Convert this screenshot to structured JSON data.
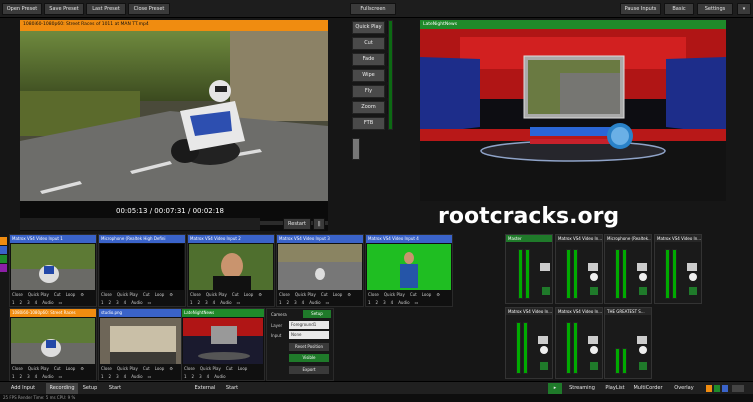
{
  "toolbar": {
    "open_preset": "Open Preset",
    "save_preset": "Save Preset",
    "last_preset": "Last Preset",
    "close_preset": "Close Preset",
    "fullscreen": "Fullscreen",
    "pause_inputs": "Pause Inputs",
    "basic": "Basic",
    "settings": "Settings"
  },
  "preview": {
    "title": "1080i60-1080p60: Street Races of 1011 at MAN TT.mp4",
    "time_elapsed": "00:05:13",
    "time_total": "00:07:31",
    "time_remaining": "00:02:18",
    "separator": "/",
    "restart": "Restart",
    "pause_glyph": "||"
  },
  "transitions": {
    "quick_play": "Quick Play",
    "cut": "Cut",
    "fade": "Fade",
    "wipe": "Wipe",
    "fly": "Fly",
    "zoom": "Zoom",
    "ftb": "FTB"
  },
  "output": {
    "title": "LateNightNews"
  },
  "watermark": "rootcracks.org",
  "inputs": [
    {
      "title": "Matrox VS4 Video Input 1",
      "color": "#3a63c9",
      "f1": [
        "Close",
        "Quick Play",
        "Cut",
        "Loop"
      ],
      "f2": [
        "1",
        "2",
        "3",
        "4",
        "Audio"
      ]
    },
    {
      "title": "Microphone (Realtek High Defini",
      "color": "#3a63c9",
      "f1": [
        "Close",
        "Quick Play",
        "Cut",
        "Loop"
      ],
      "f2": [
        "1",
        "2",
        "3",
        "4",
        "Audio"
      ]
    },
    {
      "title": "Matrox VS4 Video Input 2",
      "color": "#3a63c9",
      "f1": [
        "Close",
        "Quick Play",
        "Cut",
        "Loop"
      ],
      "f2": [
        "1",
        "2",
        "3",
        "4",
        "Audio"
      ]
    },
    {
      "title": "Matrox VS4 Video Input 3",
      "color": "#3a63c9",
      "f1": [
        "Close",
        "Quick Play",
        "Cut",
        "Loop"
      ],
      "f2": [
        "1",
        "2",
        "3",
        "4",
        "Audio"
      ]
    },
    {
      "title": "Matrox VS4 Video Input 4",
      "color": "#3a63c9",
      "f1": [
        "Close",
        "Quick Play",
        "Cut",
        "Loop"
      ],
      "f2": [
        "1",
        "2",
        "3",
        "4",
        "Audio"
      ]
    },
    {
      "title": "1080i60-1080p60: Street Races",
      "color": "#f08c10",
      "f1": [
        "Close",
        "Quick Play",
        "Cut",
        "Loop"
      ],
      "f2": [
        "1",
        "2",
        "3",
        "4",
        "Audio"
      ]
    },
    {
      "title": "studio.png",
      "color": "#3a63c9",
      "f1": [
        "Close",
        "Quick Play",
        "Cut",
        "Loop"
      ],
      "f2": [
        "1",
        "2",
        "3",
        "4",
        "Audio"
      ]
    },
    {
      "title": "LateNightNews",
      "color": "#1f8a2a",
      "f1": [
        "Close",
        "Quick Play",
        "Cut",
        "Loop"
      ],
      "f2": [
        "1",
        "2",
        "3",
        "4",
        "Audio"
      ]
    }
  ],
  "camera_panel": {
    "camera": "Camera",
    "setup": "Setup",
    "layer_label": "Layer",
    "layer_value": "Foreground1",
    "input_label": "Input",
    "input_value": "None",
    "reset_position": "Reset Position",
    "visible": "Visible",
    "export": "Export"
  },
  "mixer": [
    {
      "title": "Master"
    },
    {
      "title": "Matrox VS4 Video In..."
    },
    {
      "title": "Microphone (Realtek..."
    },
    {
      "title": "Matrox VS4 Video In..."
    },
    {
      "title": "Matrox VS4 Video In..."
    },
    {
      "title": "Matrox VS4 Video In..."
    },
    {
      "title": "THE GREATEST S..."
    }
  ],
  "bottom": {
    "add_input": "Add Input",
    "recording": "Recording",
    "setup": "Setup",
    "start": "Start",
    "external": "External",
    "start2": "Start",
    "streaming": "Streaming",
    "playlist": "PlayList",
    "multicorder": "MultiCorder",
    "overlay": "Overlay"
  },
  "status": "25 FPS  Render Time: 5 ms  CPU: 9 %",
  "colors": {
    "accent_orange": "#f08c10",
    "accent_green": "#1f8a2a",
    "accent_blue": "#3a63c9"
  }
}
